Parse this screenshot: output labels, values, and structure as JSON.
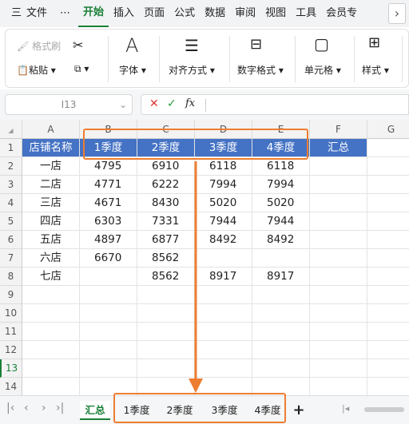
{
  "menu": {
    "hamburger": "三",
    "file": "文件",
    "more_dots": "⋯",
    "items": [
      "开始",
      "插入",
      "页面",
      "公式",
      "数据",
      "审阅",
      "视图",
      "工具",
      "会员专"
    ],
    "chevron": "›"
  },
  "toolbar": {
    "format_painter": "格式刷",
    "paste": "粘贴",
    "font": "字体",
    "align": "对齐方式",
    "number_format": "数字格式",
    "cell": "单元格",
    "style": "样式"
  },
  "formula": {
    "cell_ref": "I13",
    "fx": "fx"
  },
  "columns": [
    "A",
    "B",
    "C",
    "D",
    "E",
    "F",
    "G"
  ],
  "rows": [
    "1",
    "2",
    "3",
    "4",
    "5",
    "6",
    "7",
    "8",
    "9",
    "10",
    "11",
    "12",
    "13",
    "14"
  ],
  "table": {
    "header": [
      "店铺名称",
      "1季度",
      "2季度",
      "3季度",
      "4季度",
      "汇总"
    ],
    "data": [
      [
        "一店",
        "4795",
        "6910",
        "6118",
        "6118"
      ],
      [
        "二店",
        "4771",
        "6222",
        "7994",
        "7994"
      ],
      [
        "三店",
        "4671",
        "8430",
        "5020",
        "5020"
      ],
      [
        "四店",
        "6303",
        "7331",
        "7944",
        "7944"
      ],
      [
        "五店",
        "4897",
        "6877",
        "8492",
        "8492"
      ],
      [
        "六店",
        "6670",
        "8562",
        "",
        ""
      ],
      [
        "七店",
        "",
        "8562",
        "8917",
        "8917"
      ]
    ]
  },
  "sheets": {
    "tabs": [
      "汇总",
      "1季度",
      "2季度",
      "3季度",
      "4季度"
    ],
    "active": "汇总",
    "add": "+"
  },
  "colors": {
    "accent": "#1a7f37",
    "header_fill": "#4472c4",
    "annotation": "#ed7d31"
  }
}
